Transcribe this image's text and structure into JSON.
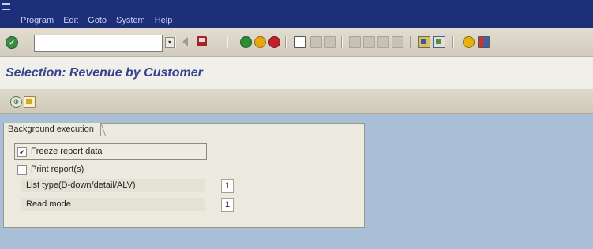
{
  "menubar": {
    "items": [
      "Program",
      "Edit",
      "Goto",
      "System",
      "Help"
    ]
  },
  "system_toolbar": {
    "ok_glyph": "✔",
    "command_field": {
      "value": "",
      "placeholder": ""
    },
    "dropdown_glyph": "▾",
    "icons": [
      "enter-icon",
      "back-arrow-icon",
      "save-icon",
      "back-icon",
      "exit-icon",
      "cancel-icon",
      "print-icon",
      "find-icon",
      "find-next-icon",
      "first-page-icon",
      "previous-page-icon",
      "next-page-icon",
      "last-page-icon",
      "create-session-icon",
      "shortcut-icon",
      "help-icon",
      "customize-layout-icon"
    ]
  },
  "title_bar": {
    "title": "Selection: Revenue by Customer"
  },
  "app_toolbar": {
    "execute_glyph": "⊕",
    "icons": [
      "execute-icon",
      "get-variant-icon"
    ]
  },
  "background_execution": {
    "group_title": "Background execution",
    "freeze_report": {
      "label": "Freeze report data",
      "checked": true,
      "mark": "✔"
    },
    "print_report": {
      "label": "Print report(s)",
      "checked": false,
      "mark": ""
    },
    "list_type": {
      "label": "List type(D-down/detail/ALV)",
      "value": "1"
    },
    "read_mode": {
      "label": "Read mode",
      "value": "1"
    }
  },
  "colors": {
    "menubar_bg": "#1e2f79",
    "title_text": "#34448f",
    "desktop_bg": "#a9bfd6",
    "panel_bg": "#ece9de"
  }
}
